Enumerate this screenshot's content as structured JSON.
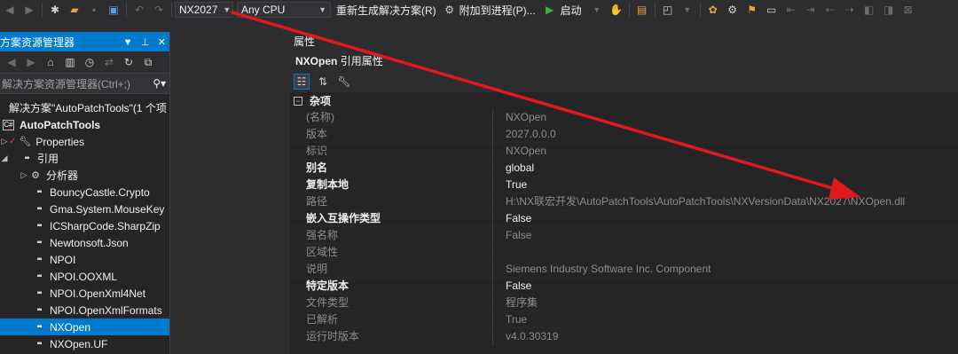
{
  "toolbar": {
    "config_dropdown": "NX2027",
    "platform_dropdown": "Any CPU",
    "rebuild_label": "重新生成解决方案(R)",
    "attach_label": "附加到进程(P)...",
    "start_label": "启动"
  },
  "solution_explorer": {
    "title": "方案资源管理器",
    "search_placeholder": "解决方案资源管理器(Ctrl+;)",
    "items": [
      {
        "label": "解决方案\"AutoPatchTools\"(1 个项"
      },
      {
        "label": "AutoPatchTools"
      },
      {
        "label": "Properties"
      },
      {
        "label": "引用"
      },
      {
        "label": "分析器"
      },
      {
        "label": "BouncyCastle.Crypto"
      },
      {
        "label": "Gma.System.MouseKey"
      },
      {
        "label": "ICSharpCode.SharpZip"
      },
      {
        "label": "Newtonsoft.Json"
      },
      {
        "label": "NPOI"
      },
      {
        "label": "NPOI.OOXML"
      },
      {
        "label": "NPOI.OpenXml4Net"
      },
      {
        "label": "NPOI.OpenXmlFormats"
      },
      {
        "label": "NXOpen"
      },
      {
        "label": "NXOpen.UF"
      }
    ]
  },
  "properties": {
    "header": "属性",
    "object_name": "NXOpen",
    "object_type": "引用属性",
    "category": "杂项",
    "rows": [
      {
        "name": "(名称)",
        "value": "NXOpen"
      },
      {
        "name": "版本",
        "value": "2027.0.0.0"
      },
      {
        "name": "标识",
        "value": "NXOpen"
      },
      {
        "name": "别名",
        "value": "global"
      },
      {
        "name": "复制本地",
        "value": "True"
      },
      {
        "name": "路径",
        "value": "H:\\NX联宏开发\\AutoPatchTools\\AutoPatchTools\\NXVersionData\\NX2027\\NXOpen.dll"
      },
      {
        "name": "嵌入互操作类型",
        "value": "False"
      },
      {
        "name": "强名称",
        "value": "False"
      },
      {
        "name": "区域性",
        "value": ""
      },
      {
        "name": "说明",
        "value": "Siemens Industry Software Inc. Component"
      },
      {
        "name": "特定版本",
        "value": "False"
      },
      {
        "name": "文件类型",
        "value": "程序集"
      },
      {
        "name": "已解析",
        "value": "True"
      },
      {
        "name": "运行时版本",
        "value": "v4.0.30319"
      }
    ]
  },
  "colors": {
    "accent": "#007acc",
    "annotation_arrow": "#e0191d",
    "background": "#2d2d30"
  },
  "icons": [
    "back-icon",
    "forward-icon",
    "new-project-icon",
    "open-folder-icon",
    "save-icon",
    "save-all-icon",
    "undo-icon",
    "redo-icon",
    "play-icon",
    "search-icon",
    "pin-icon",
    "close-icon",
    "home-icon",
    "refresh-icon",
    "categorized-icon",
    "alphabetical-icon",
    "property-pages-icon",
    "wrench-icon",
    "reference-icon"
  ]
}
